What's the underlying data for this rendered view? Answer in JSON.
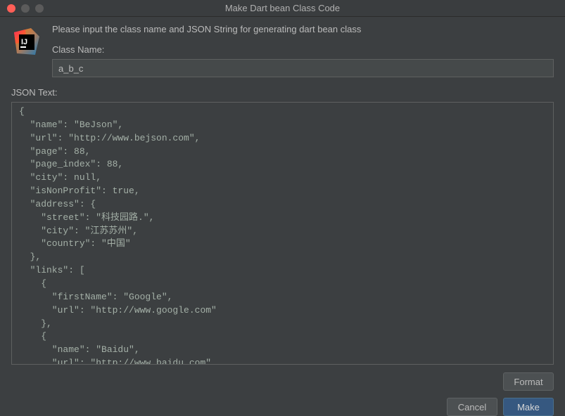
{
  "window": {
    "title": "Make Dart bean Class Code"
  },
  "instruction": "Please input the class name and JSON String for generating dart bean class",
  "classNameLabel": "Class Name:",
  "classNameValue": "a_b_c",
  "jsonTextLabel": "JSON Text:",
  "jsonTextValue": "{\n  \"name\": \"BeJson\",\n  \"url\": \"http://www.bejson.com\",\n  \"page\": 88,\n  \"page_index\": 88,\n  \"city\": null,\n  \"isNonProfit\": true,\n  \"address\": {\n    \"street\": \"科技园路.\",\n    \"city\": \"江苏苏州\",\n    \"country\": \"中国\"\n  },\n  \"links\": [\n    {\n      \"firstName\": \"Google\",\n      \"url\": \"http://www.google.com\"\n    },\n    {\n      \"name\": \"Baidu\",\n      \"url\": \"http://www.baidu.com\"\n    },",
  "buttons": {
    "format": "Format",
    "cancel": "Cancel",
    "make": "Make"
  }
}
